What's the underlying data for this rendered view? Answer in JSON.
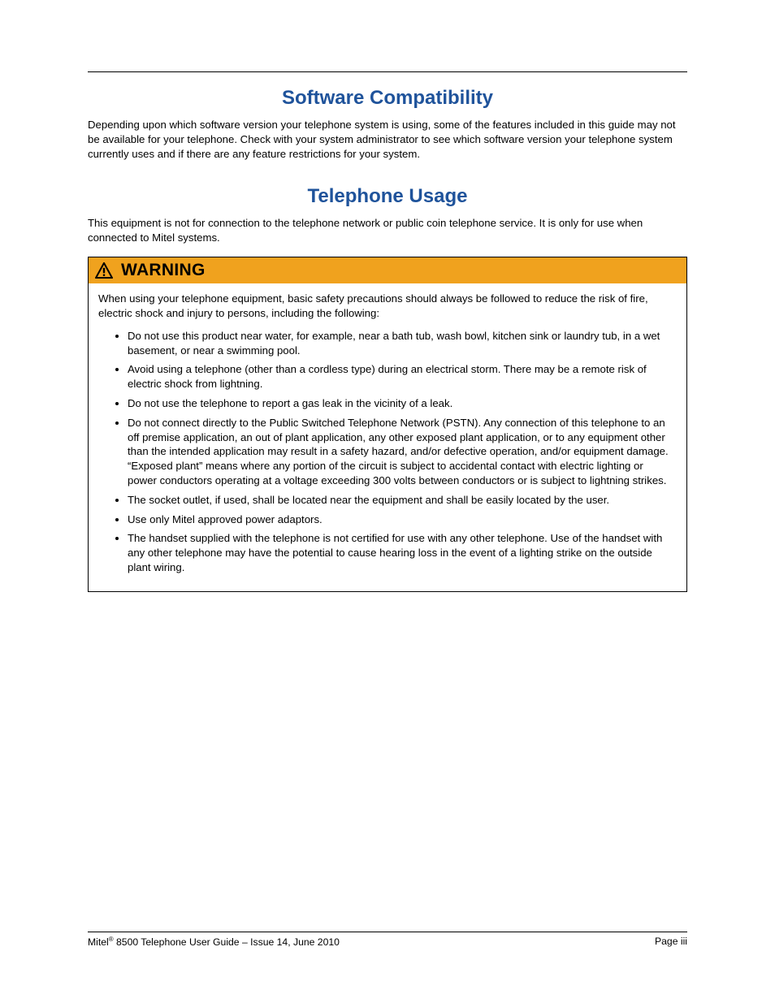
{
  "sections": {
    "software": {
      "heading": "Software Compatibility",
      "body": "Depending upon which software version your telephone system is using, some of the features included in this guide may not be available for your telephone. Check with your system administrator to see which software version your telephone system currently uses and if there are any feature restrictions for your system."
    },
    "telephone": {
      "heading": "Telephone Usage",
      "body": "This equipment is not for connection to the telephone network or public coin telephone service. It is only for use when connected to Mitel systems."
    }
  },
  "warning": {
    "title": "WARNING",
    "intro": "When using your telephone equipment, basic safety precautions should always be followed to reduce the risk of fire, electric shock and injury to persons, including the following:",
    "items": [
      "Do not use this product near water, for example, near a bath tub, wash bowl, kitchen sink or laundry tub, in a wet basement, or near a swimming pool.",
      "Avoid using a telephone (other than a cordless type) during an electrical storm. There may be a remote risk of electric shock from lightning.",
      "Do not use the telephone to report a gas leak in the vicinity of a leak.",
      "Do not connect directly to the Public Switched Telephone Network (PSTN). Any connection of this telephone to an off premise application, an out of plant application, any other exposed plant application, or to any equipment other than the intended application may result in a safety hazard, and/or defective operation, and/or equipment damage. “Exposed plant” means where any portion of the circuit is subject to accidental contact with electric lighting or power conductors operating at a voltage exceeding 300 volts between conductors or is subject to lightning strikes.",
      "The socket outlet, if used, shall be located near the equipment and shall be easily located by the user.",
      "Use only Mitel approved power adaptors.",
      "The handset supplied with the telephone is not certified for use with any other telephone. Use of the handset with any other telephone may have the potential to cause hearing loss in the event of a lighting strike on the outside plant wiring."
    ]
  },
  "footer": {
    "brand": "Mitel",
    "reg": "®",
    "doc": " 8500 Telephone User Guide – Issue 14, June 2010",
    "page": "Page iii"
  }
}
